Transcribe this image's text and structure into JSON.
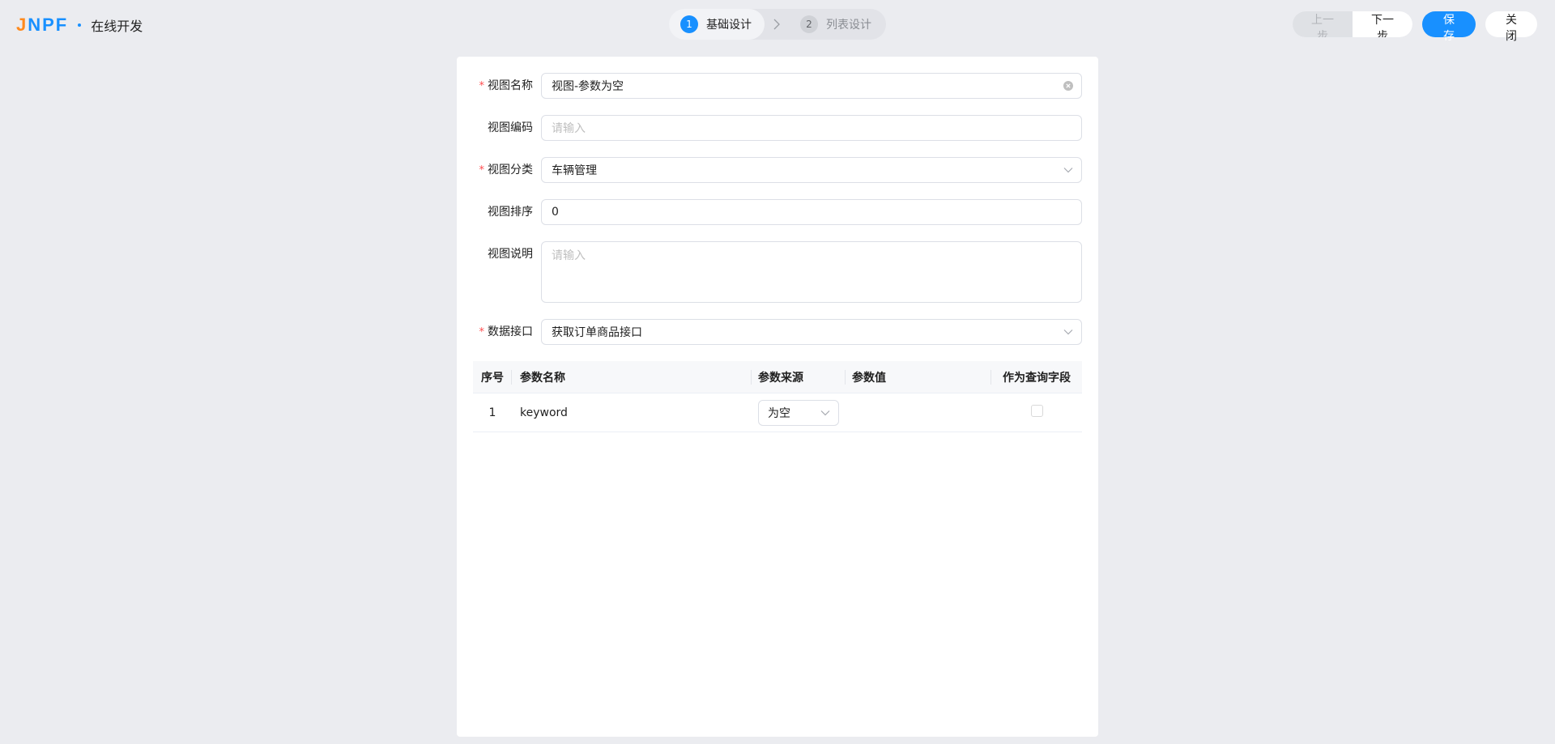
{
  "header": {
    "logo_part1": "J",
    "logo_part2": "NPF",
    "app_title": "在线开发"
  },
  "steps": [
    {
      "num": "1",
      "label": "基础设计",
      "active": true
    },
    {
      "num": "2",
      "label": "列表设计",
      "active": false
    }
  ],
  "actions": {
    "prev": "上一步",
    "next": "下一步",
    "save": "保 存",
    "close": "关 闭"
  },
  "form": {
    "name_label": "视图名称",
    "name_value": "视图-参数为空",
    "code_label": "视图编码",
    "code_placeholder": "请输入",
    "category_label": "视图分类",
    "category_value": "车辆管理",
    "sort_label": "视图排序",
    "sort_value": "0",
    "desc_label": "视图说明",
    "desc_placeholder": "请输入",
    "api_label": "数据接口",
    "api_value": "获取订单商品接口",
    "required_mark": "*"
  },
  "table": {
    "headers": {
      "index": "序号",
      "param_name": "参数名称",
      "source": "参数来源",
      "value": "参数值",
      "query_field": "作为查询字段"
    },
    "rows": [
      {
        "index": "1",
        "param_name": "keyword",
        "source": "为空",
        "value": "",
        "query_field": false
      }
    ]
  }
}
